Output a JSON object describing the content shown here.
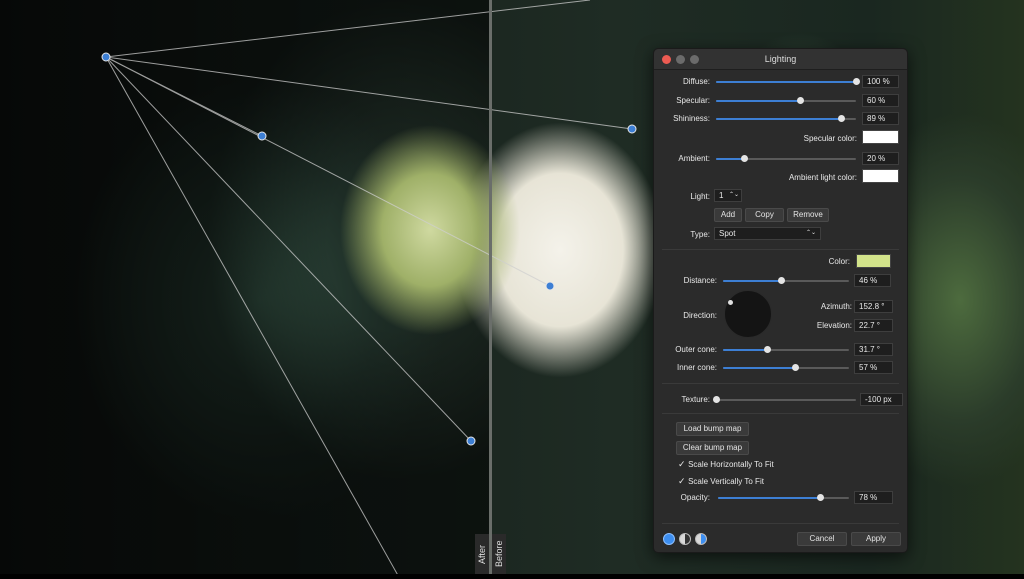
{
  "window": {
    "title": "Lighting"
  },
  "split": {
    "after": "After",
    "before": "Before"
  },
  "rows": {
    "diffuse": {
      "label": "Diffuse:",
      "value": "100 %",
      "level": 1.0
    },
    "specular": {
      "label": "Specular:",
      "value": "60 %",
      "level": 0.6
    },
    "shininess": {
      "label": "Shininess:",
      "value": "89 %",
      "level": 0.89
    },
    "specular_color": {
      "label": "Specular color:",
      "color": "#ffffff"
    },
    "ambient": {
      "label": "Ambient:",
      "value": "20 %",
      "level": 0.2
    },
    "ambient_color": {
      "label": "Ambient light color:",
      "color": "#ffffff"
    },
    "light": {
      "label": "Light:",
      "value": "1"
    },
    "type": {
      "label": "Type:",
      "value": "Spot"
    },
    "color": {
      "label": "Color:",
      "color": "#d2e38a"
    },
    "distance": {
      "label": "Distance:",
      "value": "46 %",
      "level": 0.46
    },
    "direction": {
      "label": "Direction:"
    },
    "azimuth": {
      "label": "Azimuth:",
      "value": "152.8 °"
    },
    "elevation": {
      "label": "Elevation:",
      "value": "22.7 °"
    },
    "outer_cone": {
      "label": "Outer cone:",
      "value": "31.7 °",
      "level": 0.35
    },
    "inner_cone": {
      "label": "Inner cone:",
      "value": "57 %",
      "level": 0.57
    },
    "texture": {
      "label": "Texture:",
      "value": "-100 px",
      "level": 0.0
    },
    "opacity": {
      "label": "Opacity:",
      "value": "78 %",
      "level": 0.78
    }
  },
  "buttons": {
    "add": "Add",
    "copy": "Copy",
    "remove": "Remove",
    "load_bump": "Load bump map",
    "clear_bump": "Clear bump map",
    "cancel": "Cancel",
    "apply": "Apply"
  },
  "checks": {
    "scale_h": "Scale Horizontally To Fit",
    "scale_v": "Scale Vertically To Fit"
  },
  "icons": {
    "checkmark": "✓",
    "stepper": "⌃⌄",
    "select": "⌃⌄"
  },
  "colors": {
    "accent": "#3d7fd4",
    "panel_bg": "#2b2b2b"
  }
}
